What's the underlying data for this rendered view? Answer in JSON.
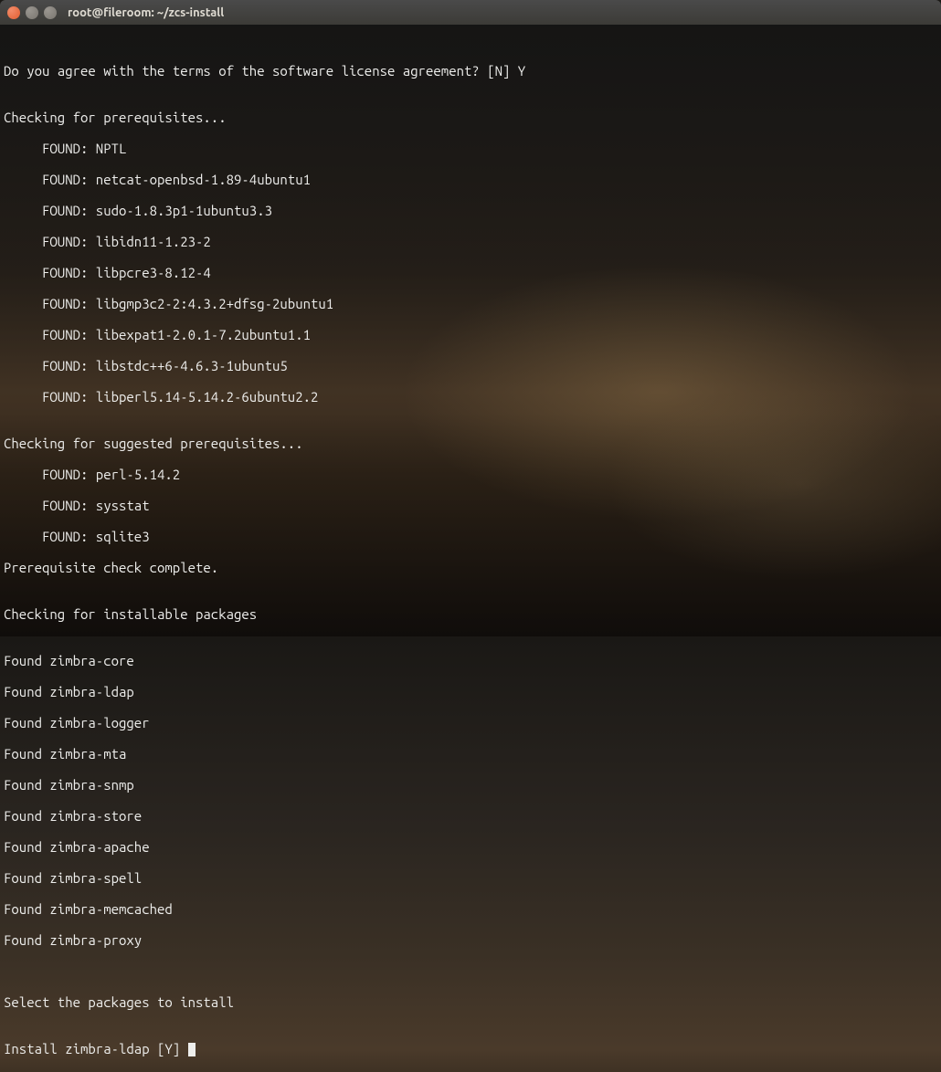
{
  "window": {
    "title": "root@fileroom: ~/zcs-install"
  },
  "terminal": {
    "license_prompt": "Do you agree with the terms of the software license agreement? [N] Y",
    "blank": "",
    "checking_prereq": "Checking for prerequisites...",
    "prereq": [
      "     FOUND: NPTL",
      "     FOUND: netcat-openbsd-1.89-4ubuntu1",
      "     FOUND: sudo-1.8.3p1-1ubuntu3.3",
      "     FOUND: libidn11-1.23-2",
      "     FOUND: libpcre3-8.12-4",
      "     FOUND: libgmp3c2-2:4.3.2+dfsg-2ubuntu1",
      "     FOUND: libexpat1-2.0.1-7.2ubuntu1.1",
      "     FOUND: libstdc++6-4.6.3-1ubuntu5",
      "     FOUND: libperl5.14-5.14.2-6ubuntu2.2"
    ],
    "checking_suggested": "Checking for suggested prerequisites...",
    "suggested": [
      "     FOUND: perl-5.14.2",
      "     FOUND: sysstat",
      "     FOUND: sqlite3"
    ],
    "prereq_complete": "Prerequisite check complete.",
    "checking_packages": "Checking for installable packages",
    "packages": [
      "Found zimbra-core",
      "Found zimbra-ldap",
      "Found zimbra-logger",
      "Found zimbra-mta",
      "Found zimbra-snmp",
      "Found zimbra-store",
      "Found zimbra-apache",
      "Found zimbra-spell",
      "Found zimbra-memcached",
      "Found zimbra-proxy"
    ],
    "select_packages": "Select the packages to install",
    "install_prompt": "Install zimbra-ldap [Y] "
  }
}
